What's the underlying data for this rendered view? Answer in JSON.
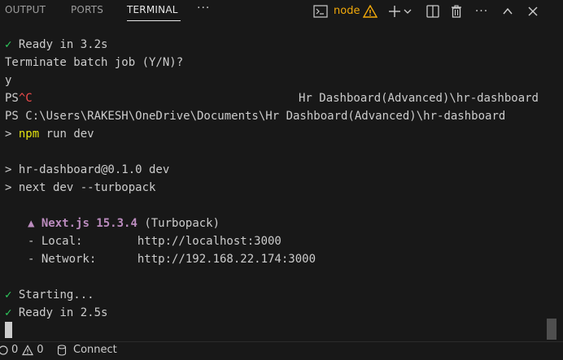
{
  "tabs": [
    {
      "label": "OUTPUT"
    },
    {
      "label": "PORTS"
    },
    {
      "label": "TERMINAL"
    }
  ],
  "toolbar": {
    "more_icon": "ellipsis-icon",
    "terminal_name": "node",
    "warning_icon": "warning-icon",
    "icons": [
      "terminal-icon",
      "warning-icon",
      "plus-icon",
      "chevron-down-icon",
      "split-icon",
      "trash-icon",
      "ellipsis-icon",
      "chevron-up-icon",
      "close-icon"
    ]
  },
  "terminal": {
    "l1_check": "✓",
    "l1_text": " Ready in 3.2s",
    "l2": "Terminate batch job (Y/N)?",
    "l3": "y",
    "l4_ps": "PS",
    "l4_ctrl": "^C",
    "l4_right": "Hr Dashboard(Advanced)\\hr-dashboard",
    "l5": "PS C:\\Users\\RAKESH\\OneDrive\\Documents\\Hr Dashboard(Advanced)\\hr-dashboard",
    "l6_prompt": ">",
    "l6_cmd": "npm",
    "l6_args": " run dev",
    "l7": "> hr-dashboard@0.1.0 dev",
    "l8": "> next dev --turbopack",
    "l9_triangle": "▲",
    "l9_name": "Next.js 15.3.4",
    "l9_rest": " (Turbopack)",
    "l10": "- Local:        http://localhost:3000",
    "l11": "- Network:      http://192.168.22.174:3000",
    "l12_check": "✓",
    "l12_text": " Starting...",
    "l13_check": "✓",
    "l13_text": " Ready in 2.5s"
  },
  "status": {
    "errors": "0",
    "warnings": "0",
    "connect": "Connect"
  },
  "colors": {
    "background": "#181818",
    "text": "#cccccc",
    "success": "#2fd15f",
    "command": "#e5e510",
    "error": "#f14c4c",
    "nextjs": "#bc8cbf",
    "warning": "#f2a90a"
  }
}
